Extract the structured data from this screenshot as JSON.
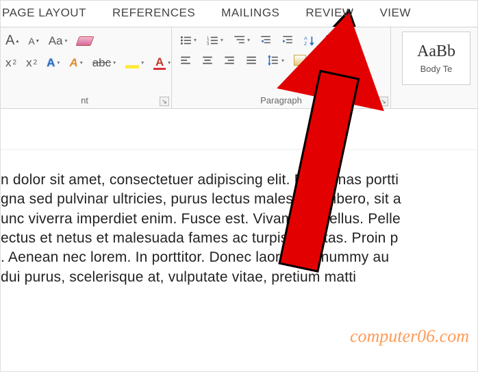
{
  "tabs": {
    "page_layout": "PAGE LAYOUT",
    "references": "REFERENCES",
    "mailings": "MAILINGS",
    "review": "REVIEW",
    "view": "VIEW"
  },
  "ribbon": {
    "font": {
      "label": "nt",
      "case_btn": "Aa",
      "grow": "A",
      "shrink": "A",
      "sub": "x",
      "sup": "x",
      "script_a1": "A",
      "script_a2": "A",
      "strike": "abc",
      "font_color": "A"
    },
    "paragraph": {
      "label": "Paragraph",
      "show_marks": "¶"
    },
    "styles": {
      "preview": "AaBb",
      "name": "Body Te"
    }
  },
  "document": {
    "l1": "n dolor sit amet, consectetuer adipiscing elit. Maecenas portti",
    "l2": "gna sed pulvinar ultricies, purus lectus malesuada libero, sit a",
    "l3": "unc viverra imperdiet enim. Fusce est. Vivamus a tellus. Pelle",
    "l4": "ectus et netus et malesuada fames ac turpis egestas. Proin p",
    "l5": ". Aenean nec lorem. In porttitor. Donec laoreet nonummy au",
    "l6": " dui purus, scelerisque at, vulputate vitae, pretium matti"
  },
  "watermark": "computer06.com"
}
